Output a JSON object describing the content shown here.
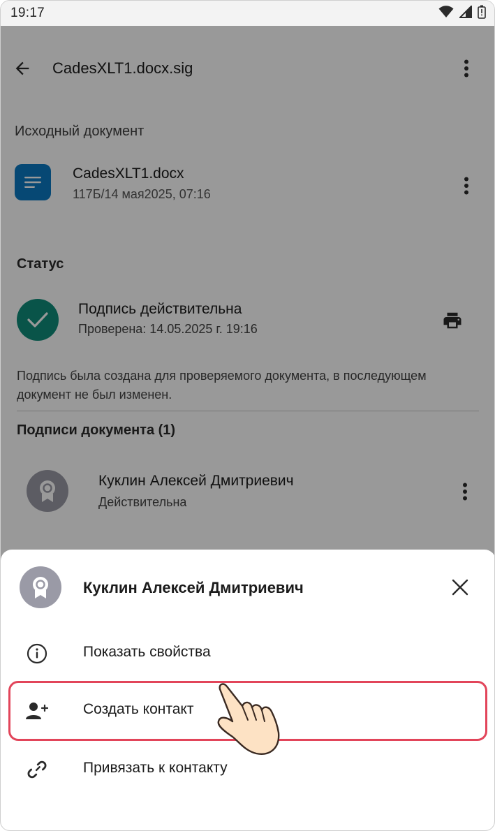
{
  "status_bar": {
    "time": "19:17",
    "icons": [
      "wifi-icon",
      "signal-icon",
      "battery-icon"
    ]
  },
  "app_bar": {
    "title": "CadesXLT1.docx.sig",
    "back_icon": "arrow-back-icon",
    "menu_icon": "more-vert-icon"
  },
  "source_document": {
    "section_label": "Исходный документ",
    "file_name": "CadesXLT1.docx",
    "file_meta": "117Б/14 мая2025, 07:16",
    "file_icon": "document-icon"
  },
  "status": {
    "section_label": "Статус",
    "title": "Подпись действительна",
    "subtitle": "Проверена: 14.05.2025 г. 19:16",
    "description": "Подпись была создана для проверяемого документа, в последующем документ не был изменен.",
    "print_icon": "print-icon"
  },
  "signatures": {
    "section_label": "Подписи документа (1)",
    "items": [
      {
        "name": "Куклин Алексей Дмитриевич",
        "status": "Действительна"
      }
    ]
  },
  "bottom_sheet": {
    "title": "Куклин Алексей Дмитриевич",
    "close_icon": "close-icon",
    "items": [
      {
        "label": "Показать свойства",
        "icon": "info-icon"
      },
      {
        "label": "Создать контакт",
        "icon": "person-add-icon"
      },
      {
        "label": "Привязать к контакту",
        "icon": "link-icon"
      }
    ]
  },
  "colors": {
    "file_icon_bg": "#0b78c2",
    "status_ok": "#0f8d7a",
    "avatar_bg": "#9a9aa6",
    "highlight": "#e2455a"
  }
}
